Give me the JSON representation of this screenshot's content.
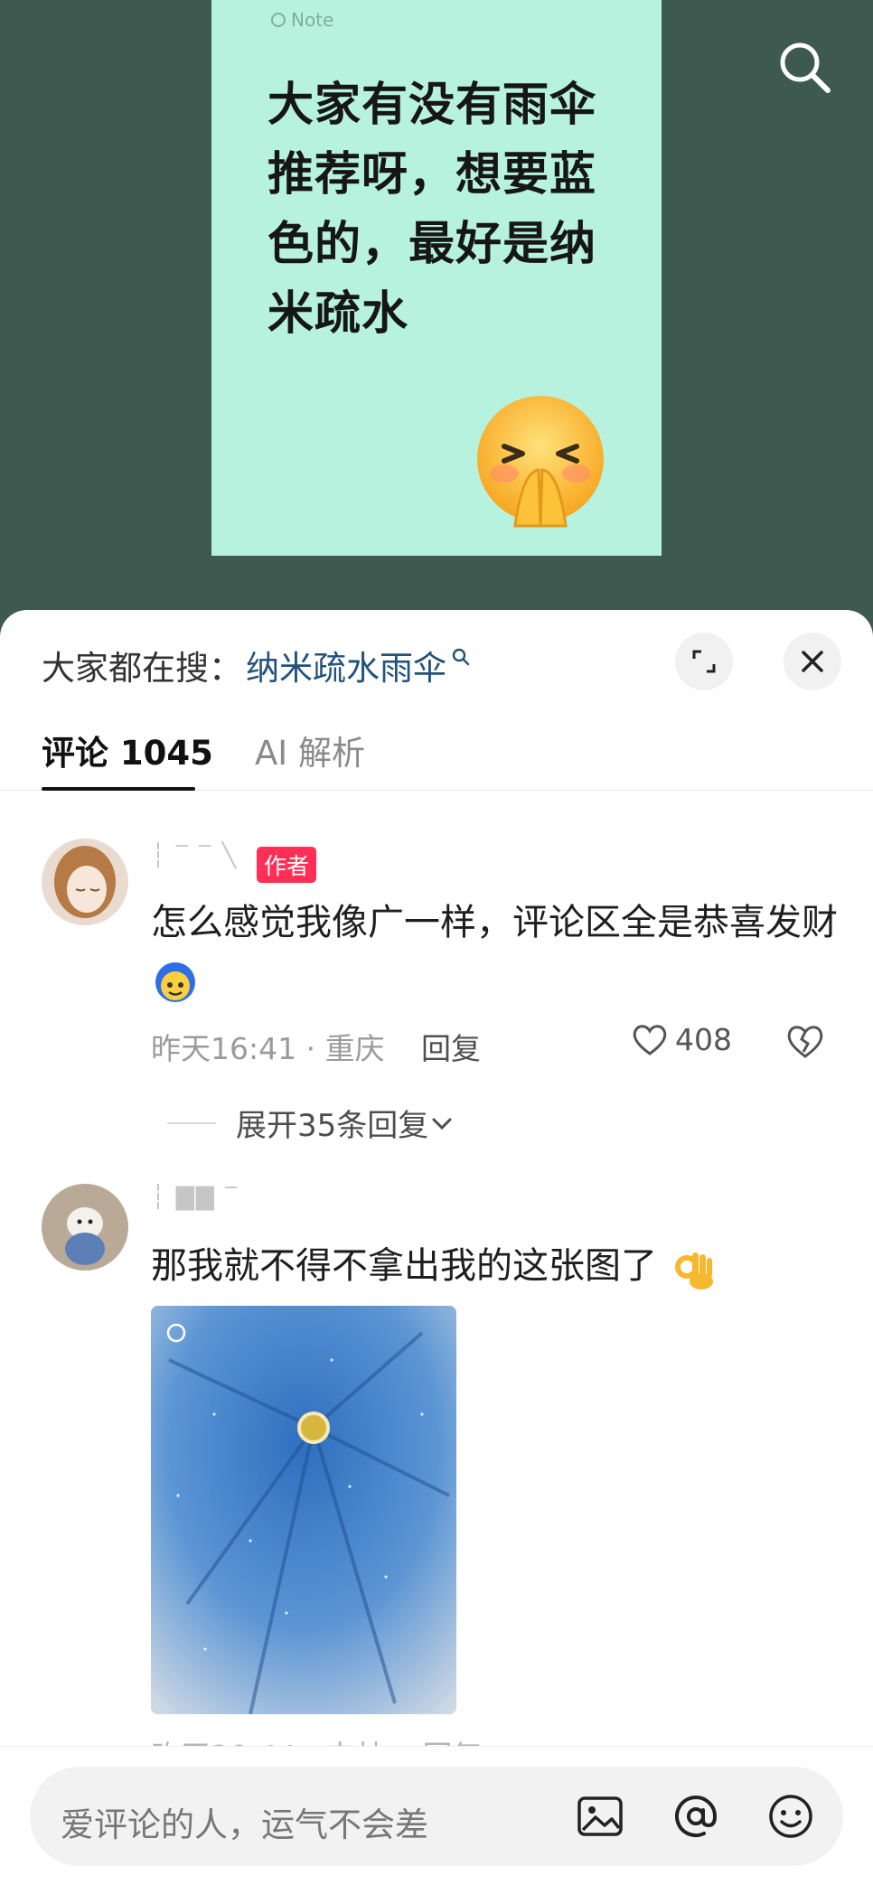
{
  "note": {
    "label": "Note",
    "text": "大家有没有雨伞推荐呀，想要蓝色的，最好是纳米疏水",
    "emoji_icon": "pleading-face-icon"
  },
  "hot_search": {
    "prefix": "大家都在搜：",
    "keyword": "纳米疏水雨伞"
  },
  "tabs": {
    "comments": "评论 1045",
    "ai": "AI 解析"
  },
  "comments": [
    {
      "badge": "作者",
      "text": "怎么感觉我像广一样，评论区全是恭喜发财",
      "meta": "昨天16:41 · 重庆",
      "reply": "回复",
      "likes": "408",
      "expand": "展开35条回复"
    },
    {
      "text": "那我就不得不拿出我的这张图了",
      "image_description_icon": "blue-umbrella-photo"
    }
  ],
  "input": {
    "placeholder": "爱评论的人，运气不会差"
  },
  "colors": {
    "note_bg": "#b6f2de",
    "background": "#3e5a50",
    "badge": "#ff2e55",
    "link": "#23527a"
  }
}
